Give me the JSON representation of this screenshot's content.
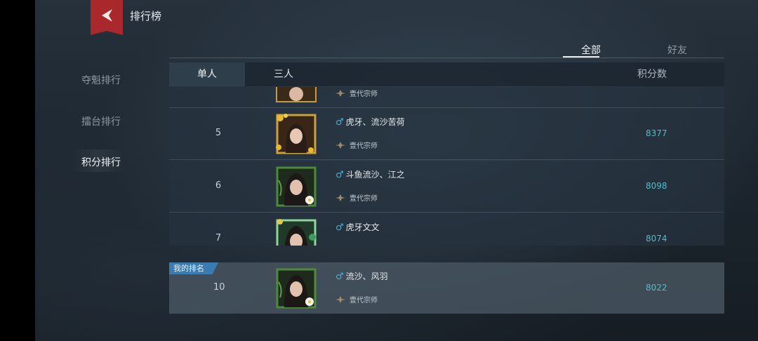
{
  "header": {
    "title": "排行榜"
  },
  "sidebar": {
    "items": [
      {
        "label": "夺魁排行"
      },
      {
        "label": "擂台排行"
      },
      {
        "label": "积分排行"
      }
    ]
  },
  "filters": {
    "all": "全部",
    "friends": "好友"
  },
  "modes": {
    "solo": "单人",
    "trio": "三人"
  },
  "columns": {
    "score": "积分数"
  },
  "rows": [
    {
      "rank": "",
      "name": "",
      "gender": "♂",
      "title": "壹代宗师",
      "score": ""
    },
    {
      "rank": "5",
      "name": "虎牙、流沙苦荷",
      "gender": "♂",
      "title": "壹代宗师",
      "score": "8377"
    },
    {
      "rank": "6",
      "name": "斗鱼流沙、江之",
      "gender": "♂",
      "title": "壹代宗师",
      "score": "8098"
    },
    {
      "rank": "7",
      "name": "虎牙文文",
      "gender": "♂",
      "title": "",
      "score": "8074"
    }
  ],
  "my_rank": {
    "badge": "我的排名",
    "rank": "10",
    "name": "流沙、风羽",
    "gender": "♂",
    "title": "壹代宗师",
    "score": "8022"
  },
  "colors": {
    "accent": "#4cc0c8",
    "back_button": "#a8282c",
    "badge": "#3c7bb0",
    "gender": "#3fb4d6"
  }
}
